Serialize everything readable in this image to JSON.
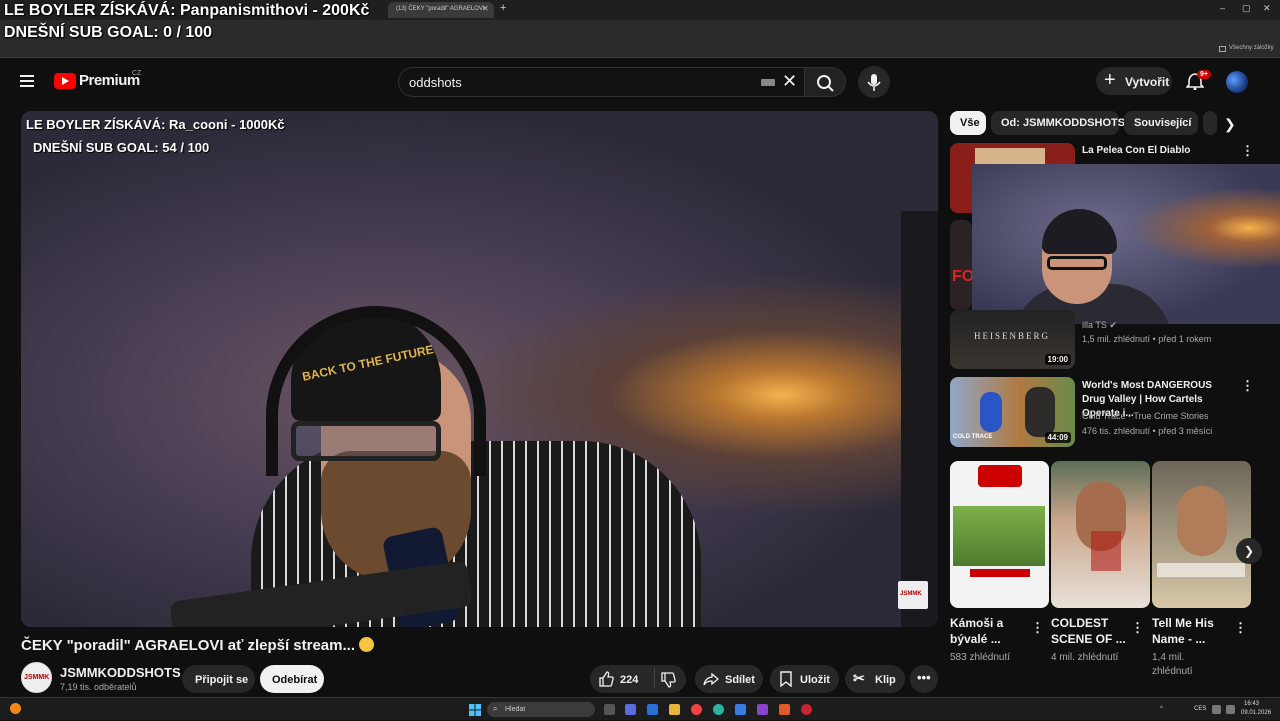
{
  "browser": {
    "active_tab_title": "(13) ČEKY \"poradil\" AGRAELOVI",
    "bookmarks_label": "Všechny záložky"
  },
  "overlay": {
    "line1": "LE BOYLER ZÍSKÁVÁ: Panpanismithovi - 200Kč",
    "line2": "DNEŠNÍ SUB GOAL: 0 / 100"
  },
  "header": {
    "brand": "Premium",
    "brand_region": "CZ",
    "search_value": "oddshots",
    "create_label": "Vytvořit",
    "notifications_badge": "9+"
  },
  "player": {
    "overlay_line1": "LE BOYLER ZÍSKÁVÁ: Ra_cooni - 1000Kč",
    "overlay_line2": "DNEŠNÍ SUB GOAL:  54 / 100",
    "cap_text": "BACK TO THE FUTURE"
  },
  "video": {
    "title": "ČEKY \"poradil\" AGRAELOVI ať zlepší stream...",
    "channel_name": "JSMMKODDSHOTS",
    "channel_subs": "7,19 tis. odběratelů",
    "join_label": "Připojit se",
    "subscribe_label": "Odebírat",
    "likes": "224",
    "share_label": "Sdílet",
    "save_label": "Uložit",
    "clip_label": "Klip"
  },
  "sidebar": {
    "chips": [
      "Vše",
      "Od: JSMMKODDSHOTS",
      "Související"
    ],
    "videos": [
      {
        "title": "La Pelea Con El Diablo",
        "duration": ""
      },
      {
        "title": "",
        "channel": "illa TS",
        "meta": "1,5 mil. zhlédnutí • před 1 rokem",
        "duration": "19:00",
        "thumb_text": "HEISENBERG"
      },
      {
        "title": "World's Most DANGEROUS Drug Valley | How Cartels Operate i...",
        "channel": "Cold Trace - True Crime Stories",
        "meta": "476 tis. zhlédnutí • před 3 měsíci",
        "duration": "44:09",
        "thumb_text": "COLD TRACE"
      }
    ],
    "shorts": [
      {
        "title_line1": "Kámoši a",
        "title_line2": "bývalé ...",
        "views": "583 zhlédnutí"
      },
      {
        "title_line1": "COLDEST",
        "title_line2": "SCENE OF ...",
        "views": "4 mil. zhlédnutí"
      },
      {
        "title_line1": "Tell Me His",
        "title_line2": "Name - ...",
        "views": "1,4 mil.",
        "views2": "zhlédnutí"
      }
    ]
  },
  "taskbar": {
    "search_placeholder": "Hledat",
    "lang": "CES",
    "time": "16:43",
    "date": "09.01.2026"
  },
  "colors": {
    "accent_red": "#ff0000",
    "background": "#0f0f0f",
    "chip_active": "#f1f1f1"
  }
}
